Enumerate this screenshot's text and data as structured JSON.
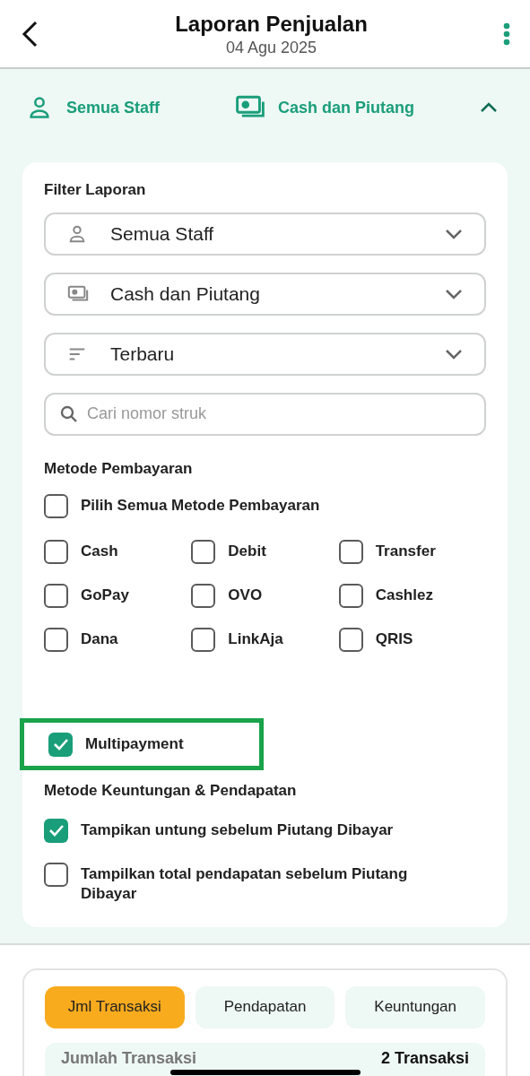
{
  "header": {
    "title": "Laporan Penjualan",
    "subtitle": "04 Agu 2025"
  },
  "summary_bar": {
    "staff": "Semua Staff",
    "payment": "Cash dan Piutang",
    "expanded": true
  },
  "filter": {
    "title": "Filter Laporan",
    "dropdowns": [
      {
        "kind": "person",
        "value": "Semua Staff"
      },
      {
        "kind": "money",
        "value": "Cash dan Piutang"
      },
      {
        "kind": "sort",
        "value": "Terbaru"
      }
    ],
    "search": {
      "placeholder": "Cari nomor struk"
    },
    "payment_section": {
      "title": "Metode Pembayaran",
      "select_all": {
        "label": "Pilih Semua Metode Pembayaran",
        "checked": false
      },
      "methods": [
        {
          "label": "Cash",
          "checked": false
        },
        {
          "label": "Debit",
          "checked": false
        },
        {
          "label": "Transfer",
          "checked": false
        },
        {
          "label": "GoPay",
          "checked": false
        },
        {
          "label": "OVO",
          "checked": false
        },
        {
          "label": "Cashlez",
          "checked": false
        },
        {
          "label": "Dana",
          "checked": false
        },
        {
          "label": "LinkAja",
          "checked": false
        },
        {
          "label": "QRIS",
          "checked": false
        }
      ],
      "multipayment": {
        "label": "Multipayment",
        "checked": true,
        "highlighted": true
      }
    },
    "profit_section": {
      "title": "Metode Keuntungan & Pendapatan",
      "options": [
        {
          "label": "Tampikan untung sebelum Piutang Dibayar",
          "checked": true
        },
        {
          "label": "Tampilkan total pendapatan sebelum Piutang Dibayar",
          "checked": false
        }
      ]
    }
  },
  "stats": {
    "tabs": [
      {
        "label": "Jml Transaksi",
        "selected": true
      },
      {
        "label": "Pendapatan",
        "selected": false
      },
      {
        "label": "Keuntungan",
        "selected": false
      }
    ],
    "rows": [
      {
        "label": "Jumlah Transaksi",
        "value": "2 Transaksi"
      }
    ]
  }
}
